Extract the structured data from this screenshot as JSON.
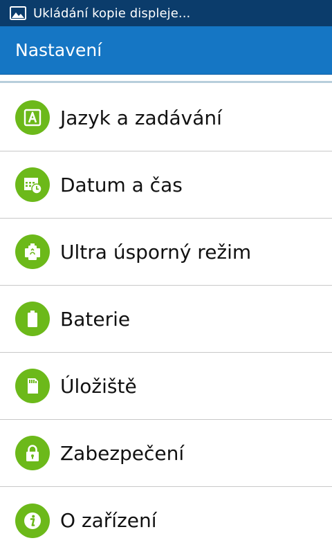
{
  "status_bar": {
    "icon": "picture-icon",
    "text": "Ukládání kopie displeje..."
  },
  "app_bar": {
    "title": "Nastavení"
  },
  "colors": {
    "status_bar": "#0b3c6b",
    "app_bar": "#1576c4",
    "icon_circle": "#6cb91a",
    "divider": "#c8c8c8"
  },
  "settings": {
    "items": [
      {
        "label": "Jazyk a zadávání",
        "icon": "language-icon"
      },
      {
        "label": "Datum a čas",
        "icon": "calendar-clock-icon"
      },
      {
        "label": "Ultra úsporný režim",
        "icon": "ultra-power-saving-icon"
      },
      {
        "label": "Baterie",
        "icon": "battery-icon"
      },
      {
        "label": "Úložiště",
        "icon": "sd-card-icon"
      },
      {
        "label": "Zabezpečení",
        "icon": "lock-icon"
      },
      {
        "label": "O zařízení",
        "icon": "info-icon"
      }
    ]
  }
}
